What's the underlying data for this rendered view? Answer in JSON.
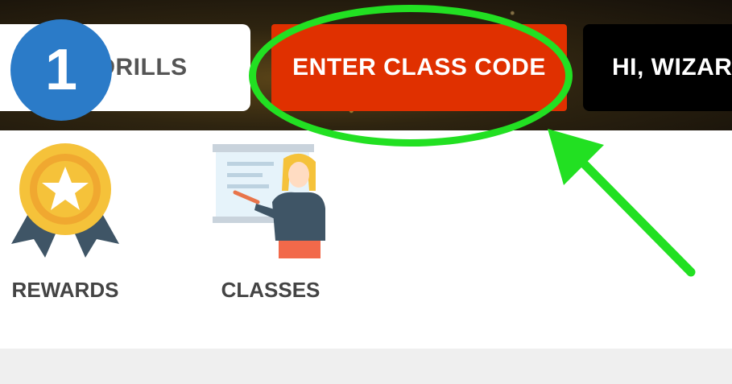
{
  "header": {
    "buttons": [
      {
        "label": "E DRILLS"
      },
      {
        "label": "ENTER CLASS CODE"
      },
      {
        "label": "HI, WIZAR"
      }
    ]
  },
  "annotation": {
    "step_number": "1",
    "highlight_color": "#22e022"
  },
  "menu": {
    "items": [
      {
        "label": "REWARDS",
        "icon": "rewards-medal-icon"
      },
      {
        "label": "CLASSES",
        "icon": "teacher-whiteboard-icon"
      }
    ]
  },
  "colors": {
    "accent_red": "#e03000",
    "badge_blue": "#2b7bc8",
    "dark_button": "#000000"
  }
}
